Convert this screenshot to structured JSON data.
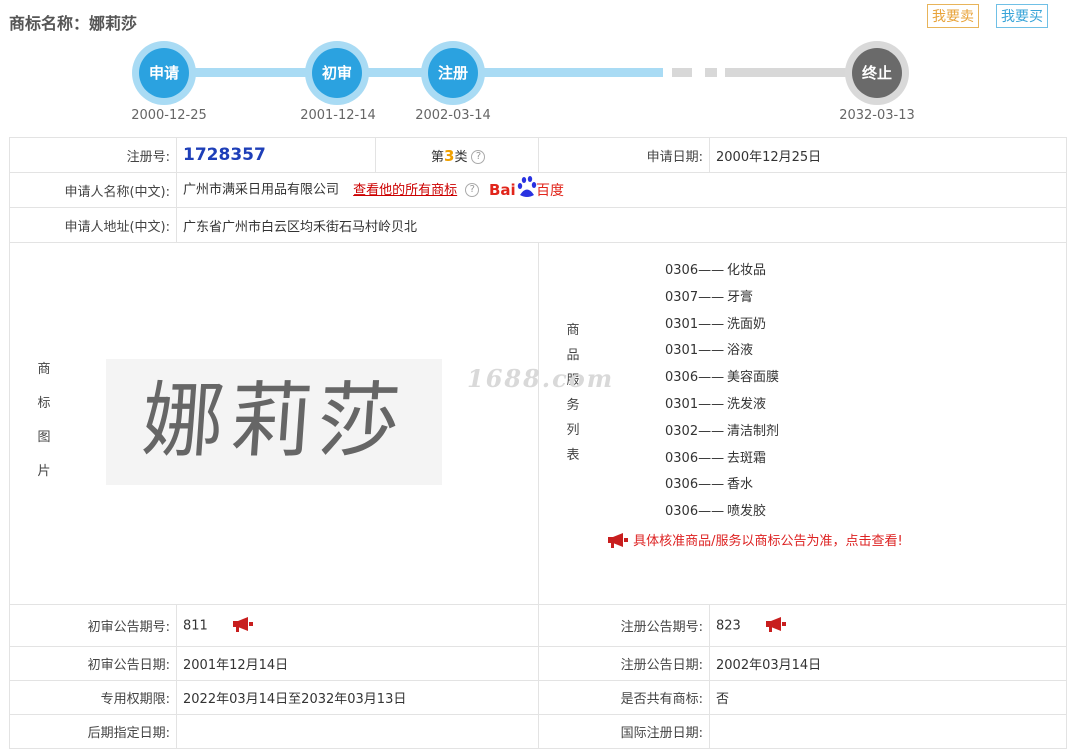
{
  "header": {
    "title": "商标名称：娜莉莎",
    "sell_label": "我要卖",
    "buy_label": "我要买"
  },
  "timeline": [
    {
      "label": "申请",
      "date": "2000-12-25"
    },
    {
      "label": "初审",
      "date": "2001-12-14"
    },
    {
      "label": "注册",
      "date": "2002-03-14"
    },
    {
      "label": "终止",
      "date": "2032-03-13"
    }
  ],
  "info": {
    "reg_no_label": "注册号:",
    "reg_no": "1728357",
    "class_prefix": "第",
    "class_num": "3",
    "class_suffix": "类",
    "apply_date_label": "申请日期:",
    "apply_date": "2000年12月25日",
    "applicant_label": "申请人名称(中文):",
    "applicant": "广州市满采日用品有限公司",
    "all_marks_link": "查看他的所有商标",
    "address_label": "申请人地址(中文):",
    "address": "广东省广州市白云区均禾街石马村岭贝北",
    "image_label": [
      "商",
      "标",
      "图",
      "片"
    ],
    "mark_text": "娜莉莎",
    "watermark": "1688.com",
    "goods_label": [
      "商",
      "品",
      "服",
      "务",
      "列",
      "表"
    ],
    "goods": [
      {
        "code": "0306——",
        "name": "化妆品"
      },
      {
        "code": "0307——",
        "name": "牙膏"
      },
      {
        "code": "0301——",
        "name": "洗面奶"
      },
      {
        "code": "0301——",
        "name": "浴液"
      },
      {
        "code": "0306——",
        "name": "美容面膜"
      },
      {
        "code": "0301——",
        "name": "洗发液"
      },
      {
        "code": "0302——",
        "name": "清洁制剂"
      },
      {
        "code": "0306——",
        "name": "去斑霜"
      },
      {
        "code": "0306——",
        "name": "香水"
      },
      {
        "code": "0306——",
        "name": "喷发胶"
      }
    ],
    "goods_notice": "具体核准商品/服务以商标公告为准，点击查看!",
    "prelim_no_label": "初审公告期号:",
    "prelim_no": "811",
    "reg_notice_no_label": "注册公告期号:",
    "reg_notice_no": "823",
    "prelim_date_label": "初审公告日期:",
    "prelim_date": "2001年12月14日",
    "reg_notice_date_label": "注册公告日期:",
    "reg_notice_date": "2002年03月14日",
    "exclusive_label": "专用权期限:",
    "exclusive": "2022年03月14日至2032年03月13日",
    "shared_label": "是否共有商标:",
    "shared": "否",
    "later_label": "后期指定日期:",
    "later": "",
    "intl_label": "国际注册日期:",
    "intl": ""
  },
  "colors": {
    "timeline_active": "#2ba2e0",
    "timeline_track": "#a9dbf4",
    "timeline_end": "#6a6a6a",
    "reg_no": "#1e3fb8",
    "notice": "#dd2222"
  }
}
